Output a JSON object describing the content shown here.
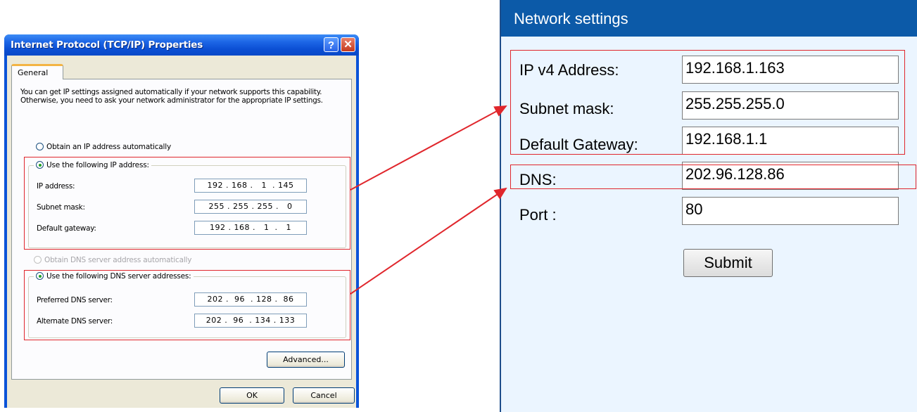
{
  "dialog": {
    "title": "Internet Protocol (TCP/IP) Properties",
    "help_glyph": "?",
    "close_glyph": "✕",
    "tab_general": "General",
    "intro_text": "You can get IP settings assigned automatically if your network supports this capability. Otherwise, you need to ask your network administrator for the appropriate IP settings.",
    "radio_obtain_ip": "Obtain an IP address automatically",
    "radio_use_ip": "Use the following IP address:",
    "ip_address_label": "IP address:",
    "ip_address_value": "192 . 168 .   1  . 145",
    "subnet_label": "Subnet mask:",
    "subnet_value": "255 . 255 . 255 .   0",
    "gateway_label": "Default gateway:",
    "gateway_value": "192 . 168 .   1  .   1",
    "radio_obtain_dns": "Obtain DNS server address automatically",
    "radio_use_dns": "Use the following DNS server addresses:",
    "preferred_dns_label": "Preferred DNS server:",
    "preferred_dns_value": "202 .  96  . 128 .  86",
    "alternate_dns_label": "Alternate DNS server:",
    "alternate_dns_value": "202 .  96  . 134 . 133",
    "advanced_button": "Advanced...",
    "ok_button": "OK",
    "cancel_button": "Cancel"
  },
  "network_settings": {
    "title": "Network settings",
    "ipv4_label": "IP v4 Address:",
    "ipv4_value": "192.168.1.163",
    "subnet_label": "Subnet mask:",
    "subnet_value": "255.255.255.0",
    "gateway_label": "Default Gateway:",
    "gateway_value": "192.168.1.1",
    "dns_label": "DNS:",
    "dns_value": "202.96.128.86",
    "port_label": "Port :",
    "port_value": "80",
    "submit_button": "Submit"
  },
  "colors": {
    "highlight_red": "#e0262c",
    "xp_title_blue": "#0a53d8",
    "net_header_blue": "#0c5aa8",
    "net_panel_bg": "#ebf5ff"
  }
}
